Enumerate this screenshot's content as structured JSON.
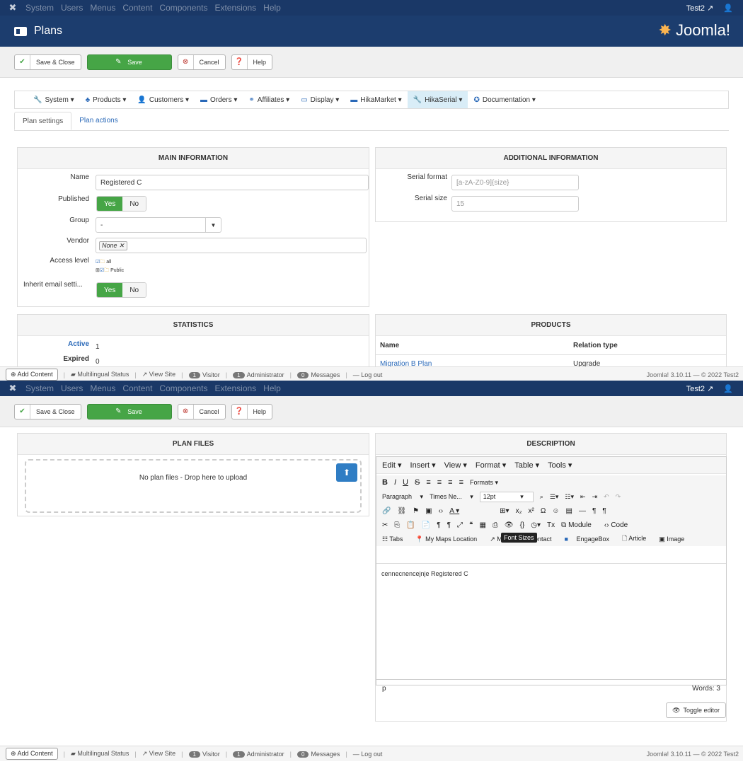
{
  "topnav": {
    "menus": [
      "System",
      "Users",
      "Menus",
      "Content",
      "Components",
      "Extensions",
      "Help"
    ],
    "site": "Test2 ↗",
    "user": "👤"
  },
  "header": {
    "title": "Plans",
    "brand": "Joomla!"
  },
  "toolbar": {
    "save_close": "Save & Close",
    "save": "Save",
    "cancel": "Cancel",
    "help": "Help"
  },
  "hikamenu": [
    {
      "label": "System ▾",
      "icon": "🔧"
    },
    {
      "label": "Products ▾",
      "icon": "♣"
    },
    {
      "label": "Customers ▾",
      "icon": "👤"
    },
    {
      "label": "Orders ▾",
      "icon": "▬"
    },
    {
      "label": "Affiliates ▾",
      "icon": "⚭"
    },
    {
      "label": "Display ▾",
      "icon": "▭"
    },
    {
      "label": "HikaMarket ▾",
      "icon": "▬"
    },
    {
      "label": "HikaSerial ▾",
      "icon": "🔧"
    },
    {
      "label": "Documentation ▾",
      "icon": "✪"
    }
  ],
  "subtabs": [
    "Plan settings",
    "Plan actions"
  ],
  "main": {
    "title": "MAIN INFORMATION",
    "name_label": "Name",
    "name_value": "Registered C",
    "published_label": "Published",
    "yes": "Yes",
    "no": "No",
    "group_label": "Group",
    "group_value": "-",
    "vendor_label": "Vendor",
    "vendor_value": "None ✕",
    "access_label": "Access level",
    "access_all": "all",
    "access_public": "Public",
    "inherit_label": "Inherit email setti..."
  },
  "additional": {
    "title": "ADDITIONAL INFORMATION",
    "format_label": "Serial format",
    "format_placeholder": "[a-zA-Z0-9]{size}",
    "size_label": "Serial size",
    "size_placeholder": "15"
  },
  "statistics": {
    "title": "STATISTICS",
    "active_label": "Active",
    "active_value": "1",
    "expired_label": "Expired",
    "expired_value": "0"
  },
  "products": {
    "title": "PRODUCTS",
    "col_name": "Name",
    "col_relation": "Relation type",
    "row_name": "Migration B Plan",
    "row_relation": "Upgrade"
  },
  "footer": {
    "add": "Add Content",
    "multilingual": "Multilingual Status",
    "viewsite": "View Site",
    "visitor_count": "1",
    "visitor": "Visitor",
    "admin_count": "1",
    "admin": "Administrator",
    "msg_count": "0",
    "messages": "Messages",
    "logout": "Log out",
    "version": "Joomla! 3.10.11 — © 2022 Test2"
  },
  "files": {
    "title": "PLAN FILES",
    "empty": "No plan files - Drop here to upload"
  },
  "description": {
    "title": "DESCRIPTION",
    "menus": [
      "Edit ▾",
      "Insert ▾",
      "View ▾",
      "Format ▾",
      "Table ▾",
      "Tools ▾"
    ],
    "formats": "Formats ▾",
    "paragraph": "Paragraph",
    "font": "Times Ne...",
    "size": "12pt",
    "tooltip": "Font Sizes",
    "plugins": [
      "Tabs",
      "My Maps Location",
      "Menu",
      "Contact",
      "EngageBox",
      "Article",
      "Image"
    ],
    "module": "Module",
    "code": "Code",
    "content": "cennecnencejnje Registered C",
    "path": "p",
    "words": "Words: 3",
    "toggle": "Toggle editor"
  }
}
